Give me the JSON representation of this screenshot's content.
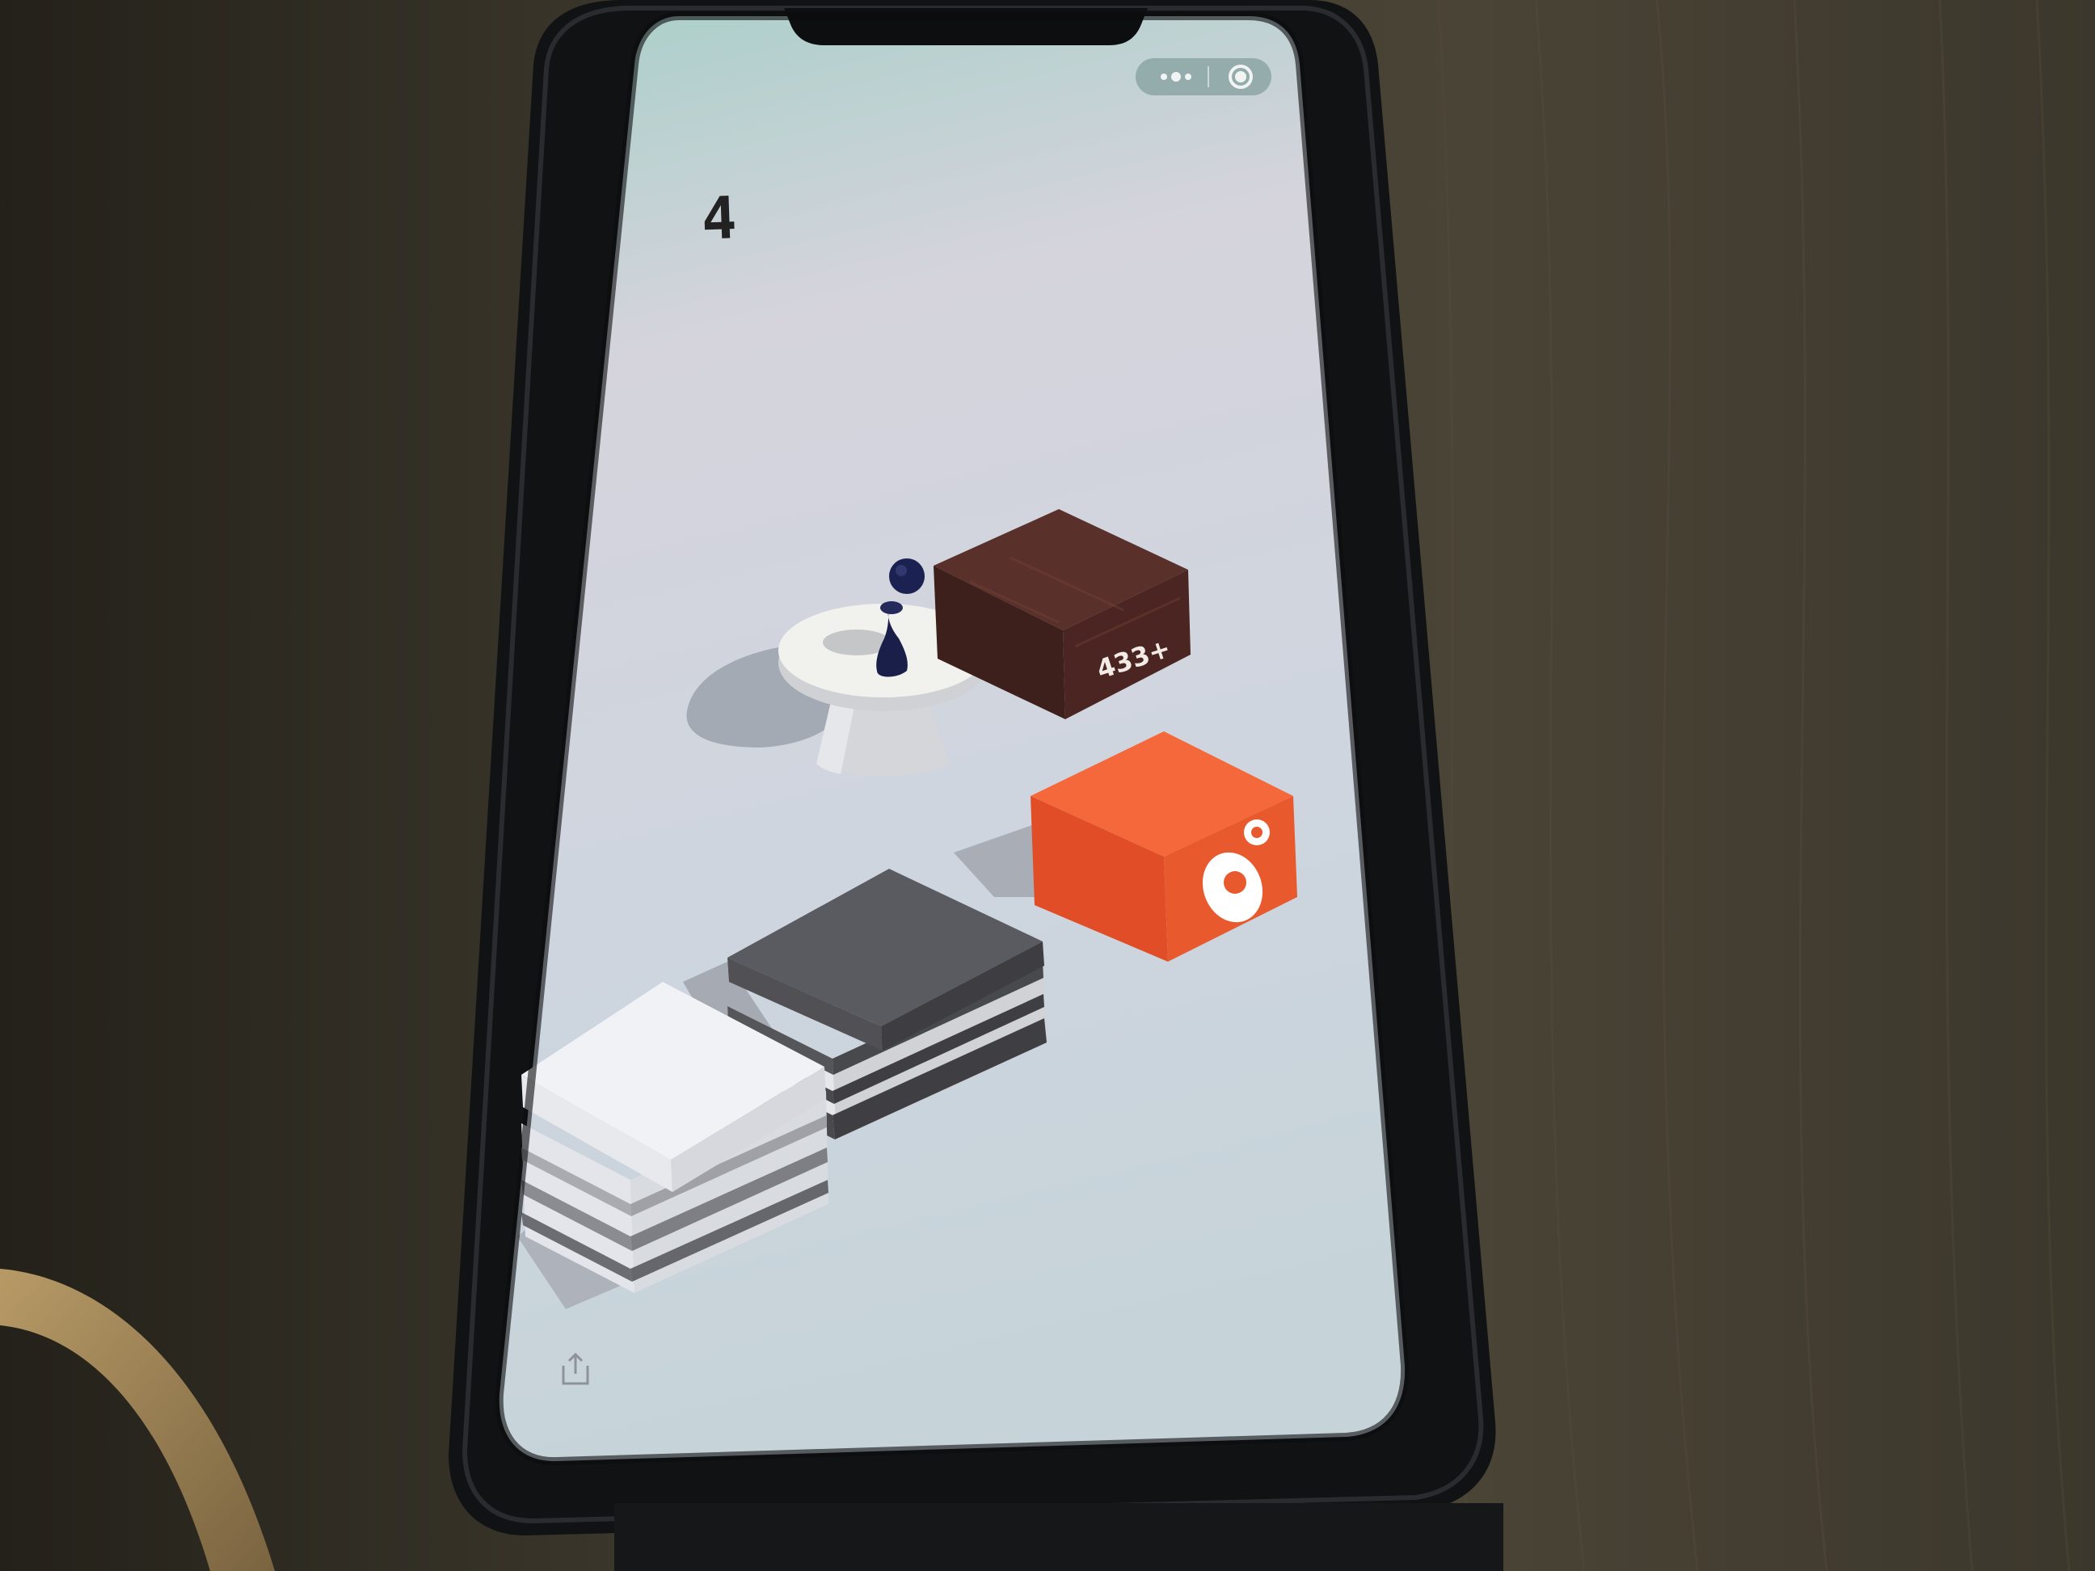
{
  "game": {
    "score": "4",
    "box_label": "433+"
  },
  "colors": {
    "screen_top": "#a9cfc9",
    "screen_mid": "#d2d7e0",
    "screen_bottom": "#c9d2dc",
    "brown_box": "#4a2521",
    "orange_box": "#e8502a",
    "dark_stack": "#4e4e52",
    "white_stack": "#eeeff3",
    "player": "#1a1f4a",
    "pedestal": "#eeeeea"
  },
  "icons": {
    "capsule_menu": "menu-dots-icon",
    "capsule_close": "close-circle-icon",
    "share": "share-icon",
    "orange_box_logo": "eye-logo-icon"
  }
}
